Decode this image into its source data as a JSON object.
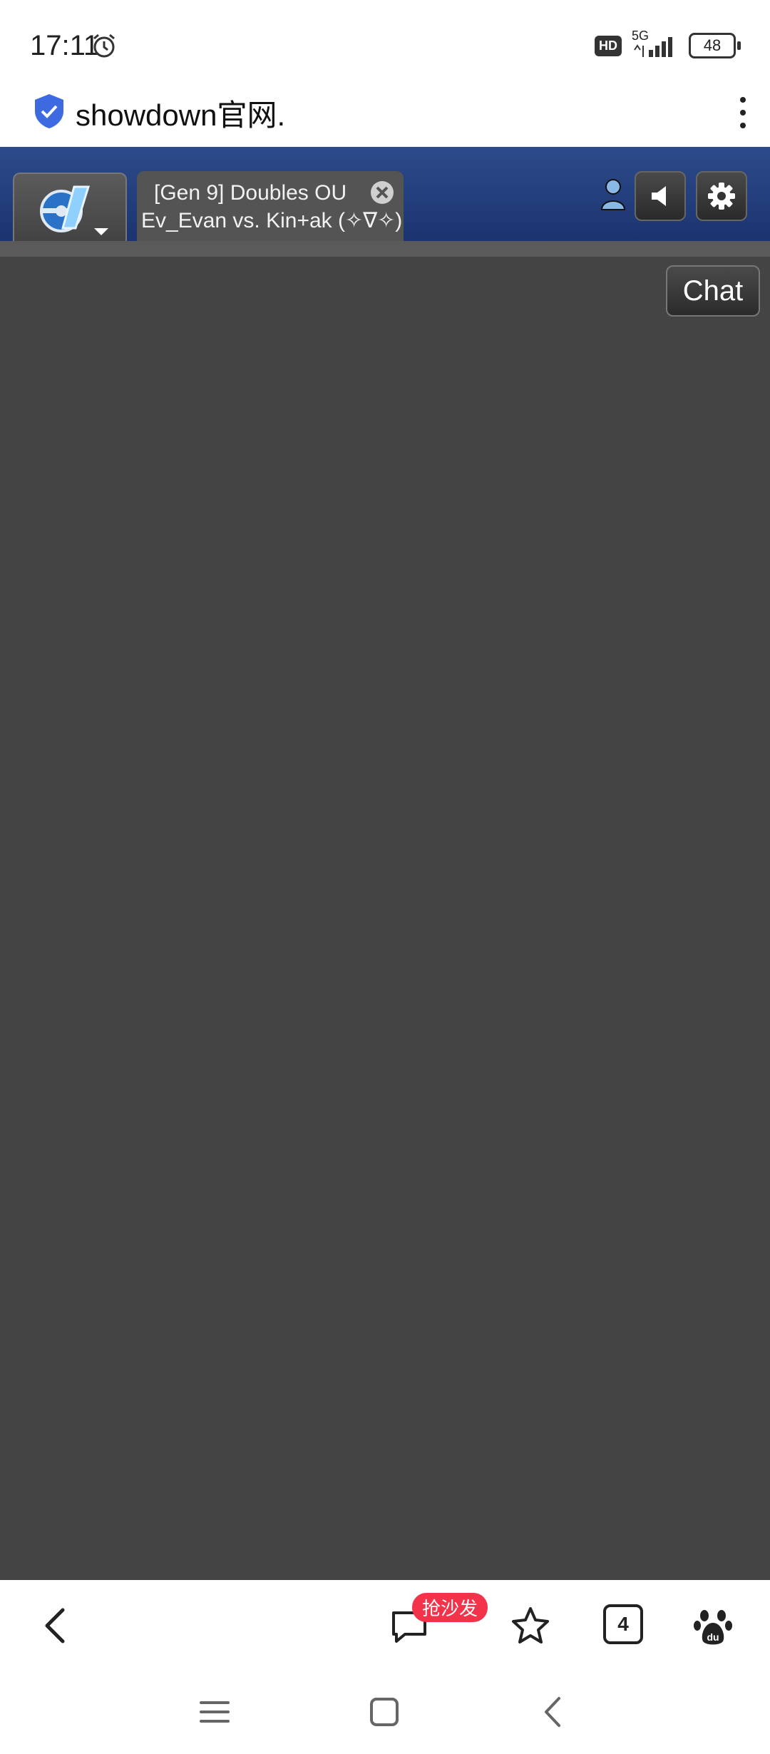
{
  "status_bar": {
    "time": "17:11",
    "hd": "HD",
    "network": "5G",
    "battery": "48"
  },
  "browser": {
    "url_text": "showdown官网."
  },
  "header": {
    "battle_tab": {
      "line1": "[Gen 9] Doubles OU",
      "line2": "Ev_Evan vs. Kin+ak (✧∇✧)"
    }
  },
  "chat_button": "Chat",
  "bottom_nav": {
    "badge": "抢沙发",
    "tabs_count": "4"
  },
  "colors": {
    "header_bg": "#1b3470",
    "battle_bg": "#444444",
    "badge": "#f2334a"
  }
}
